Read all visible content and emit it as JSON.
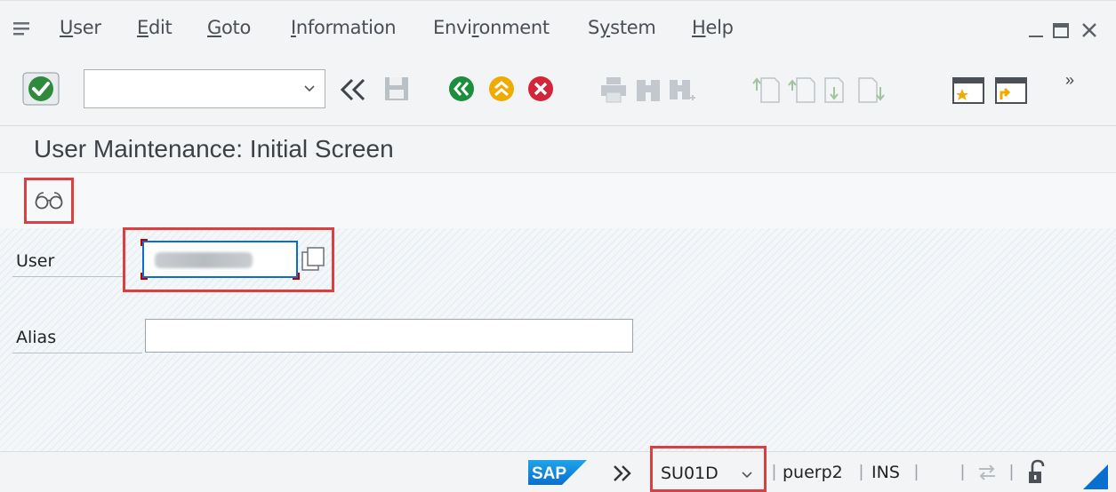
{
  "menubar": {
    "items": [
      {
        "label_u": "U",
        "label_rest": "ser"
      },
      {
        "label_u": "E",
        "label_rest": "dit"
      },
      {
        "label_u": "G",
        "label_rest": "oto"
      },
      {
        "label_u": "I",
        "label_rest": "nformation"
      },
      {
        "label_pre": "Envi",
        "label_u": "r",
        "label_rest": "onment"
      },
      {
        "label_pre": "S",
        "label_u": "y",
        "label_rest": "stem"
      },
      {
        "label_u": "H",
        "label_rest": "elp"
      }
    ]
  },
  "toolbar": {
    "command_value": "",
    "more": "»"
  },
  "page": {
    "title": "User Maintenance: Initial Screen"
  },
  "form": {
    "user_label": "User",
    "user_value": "",
    "alias_label": "Alias",
    "alias_value": ""
  },
  "statusbar": {
    "logo": "SAP",
    "transaction": "SU01D",
    "system": "puerp2",
    "mode": "INS"
  },
  "colors": {
    "highlight": "#d9403f",
    "ok_green": "#2f8a3c",
    "nav_green": "#1e8e3e",
    "nav_orange": "#f0ab00",
    "nav_red": "#d3263a",
    "sap_blue": "#0a6ed1"
  }
}
